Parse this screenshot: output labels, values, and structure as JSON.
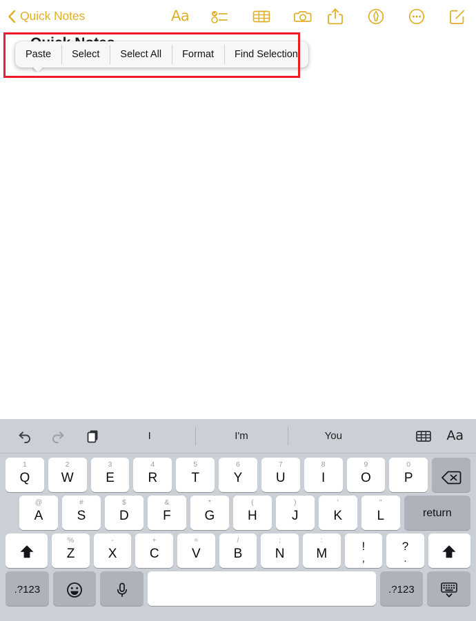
{
  "navbar": {
    "back_label": "Quick Notes",
    "back_icon": "chevron-left-icon",
    "accent_color": "#e0af29",
    "center_icons": [
      {
        "name": "text-format-icon",
        "label": "Aa"
      },
      {
        "name": "checklist-icon",
        "label": ""
      },
      {
        "name": "table-icon",
        "label": ""
      },
      {
        "name": "camera-icon",
        "label": ""
      }
    ],
    "right_icons": [
      {
        "name": "share-icon",
        "label": ""
      },
      {
        "name": "markup-pen-icon",
        "label": ""
      },
      {
        "name": "more-ellipsis-icon",
        "label": ""
      },
      {
        "name": "compose-icon",
        "label": ""
      }
    ]
  },
  "note": {
    "title": "Quick Notes",
    "body_text": ""
  },
  "context_menu": {
    "items": [
      {
        "label": "Paste"
      },
      {
        "label": "Select"
      },
      {
        "label": "Select All"
      },
      {
        "label": "Format"
      },
      {
        "label": "Find Selection"
      }
    ]
  },
  "highlight": {
    "color": "#ec1c24"
  },
  "keyboard": {
    "predictive_bar": {
      "left_icons": [
        {
          "name": "undo-icon"
        },
        {
          "name": "redo-icon"
        },
        {
          "name": "paste-clipboard-icon"
        }
      ],
      "suggestions": [
        "I",
        "I'm",
        "You"
      ],
      "right_icons": [
        {
          "name": "table-icon"
        }
      ],
      "right_label": "Aa"
    },
    "row1": [
      {
        "main": "Q",
        "alt": "1"
      },
      {
        "main": "W",
        "alt": "2"
      },
      {
        "main": "E",
        "alt": "3"
      },
      {
        "main": "R",
        "alt": "4"
      },
      {
        "main": "T",
        "alt": "5"
      },
      {
        "main": "Y",
        "alt": "6"
      },
      {
        "main": "U",
        "alt": "7"
      },
      {
        "main": "I",
        "alt": "8"
      },
      {
        "main": "O",
        "alt": "9"
      },
      {
        "main": "P",
        "alt": "0"
      }
    ],
    "backspace": {
      "name": "backspace-icon",
      "label": ""
    },
    "row2": [
      {
        "main": "A",
        "alt": "@"
      },
      {
        "main": "S",
        "alt": "#"
      },
      {
        "main": "D",
        "alt": "$"
      },
      {
        "main": "F",
        "alt": "&"
      },
      {
        "main": "G",
        "alt": "*"
      },
      {
        "main": "H",
        "alt": "("
      },
      {
        "main": "J",
        "alt": ")"
      },
      {
        "main": "K",
        "alt": "'"
      },
      {
        "main": "L",
        "alt": "\""
      }
    ],
    "return_label": "return",
    "row3": [
      {
        "main": "Z",
        "alt": "%"
      },
      {
        "main": "X",
        "alt": "-"
      },
      {
        "main": "C",
        "alt": "+"
      },
      {
        "main": "V",
        "alt": "="
      },
      {
        "main": "B",
        "alt": "/"
      },
      {
        "main": "N",
        "alt": ";"
      },
      {
        "main": "M",
        "alt": ":"
      }
    ],
    "punct_keys": [
      {
        "main": "!",
        "sub": ","
      },
      {
        "main": "?",
        "sub": "."
      }
    ],
    "shift_left": {
      "name": "shift-icon"
    },
    "shift_right": {
      "name": "shift-icon"
    },
    "row4": {
      "numeric_left": ".?123",
      "emoji": "emoji-smiley-icon",
      "mic": "microphone-icon",
      "space": "",
      "numeric_right": ".?123",
      "dismiss": "dismiss-keyboard-icon"
    }
  }
}
